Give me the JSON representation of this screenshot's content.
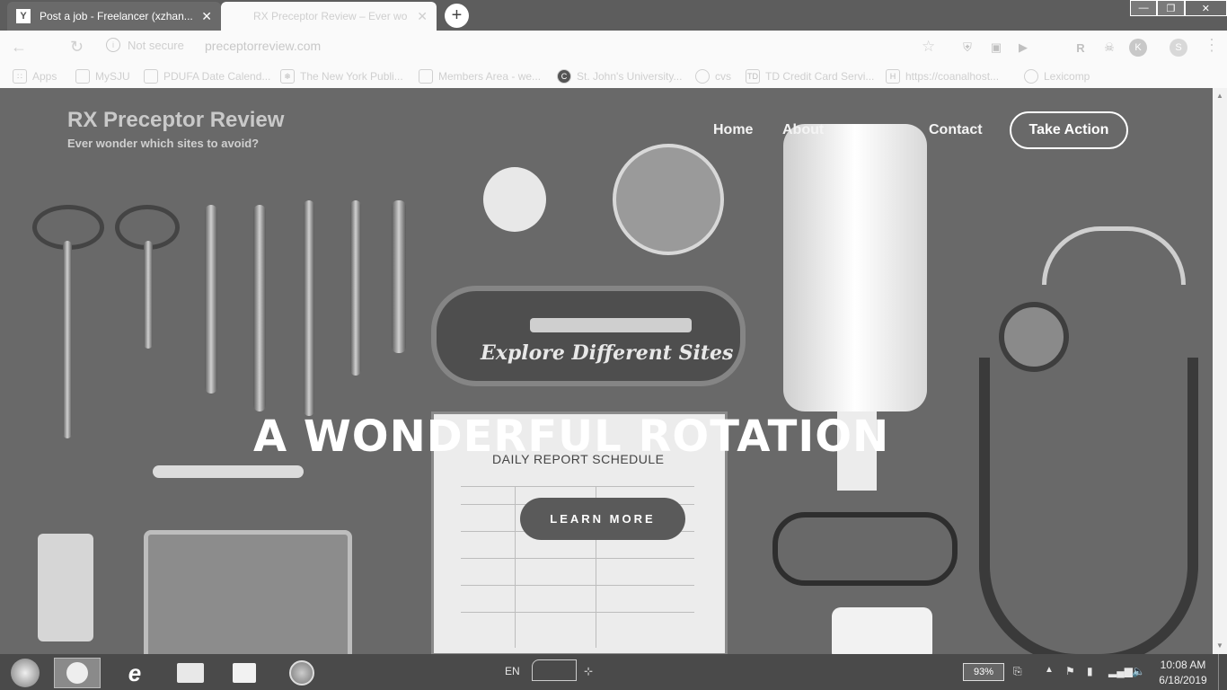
{
  "browser": {
    "tabs": [
      {
        "title": "Post a job - Freelancer (xzhan...",
        "icon": "freelancer-icon",
        "active": false
      },
      {
        "title": "RX Preceptor Review – Ever wo",
        "icon": "page-icon",
        "active": true
      }
    ],
    "new_tab": "+",
    "url_status": "Not secure",
    "url": "preceptorreview.com",
    "profile_initials": [
      "R",
      "K",
      "S"
    ]
  },
  "bookmarks": [
    {
      "label": "Apps",
      "icon": "apps-grid-icon"
    },
    {
      "label": "MySJU",
      "icon": "bookmark-icon"
    },
    {
      "label": "PDUFA Date Calend...",
      "icon": "bookmark-icon"
    },
    {
      "label": "The New York Publi...",
      "icon": "nypl-icon"
    },
    {
      "label": "Members Area - we...",
      "icon": "bookmark-icon"
    },
    {
      "label": "St. John's University...",
      "icon": "sju-icon"
    },
    {
      "label": "cvs",
      "icon": "globe-icon"
    },
    {
      "label": "TD Credit Card Servi...",
      "icon": "td-icon"
    },
    {
      "label": "https://coanalhost...",
      "icon": "host-icon"
    },
    {
      "label": "Lexicomp",
      "icon": "globe-icon"
    }
  ],
  "site": {
    "title": "RX Preceptor Review",
    "tagline": "Ever wonder which sites to avoid?",
    "nav": [
      "Home",
      "About",
      "Contact"
    ],
    "cta": "Take Action",
    "hero_subtitle": "Explore Different Sites",
    "hero_title": "A WONDERFUL ROTATION",
    "hero_button": "LEARN MORE",
    "clipboard_heading": "DAILY REPORT SCHEDULE"
  },
  "taskbar": {
    "language": "EN",
    "battery": "93%",
    "time": "10:08 AM",
    "date": "6/18/2019"
  }
}
